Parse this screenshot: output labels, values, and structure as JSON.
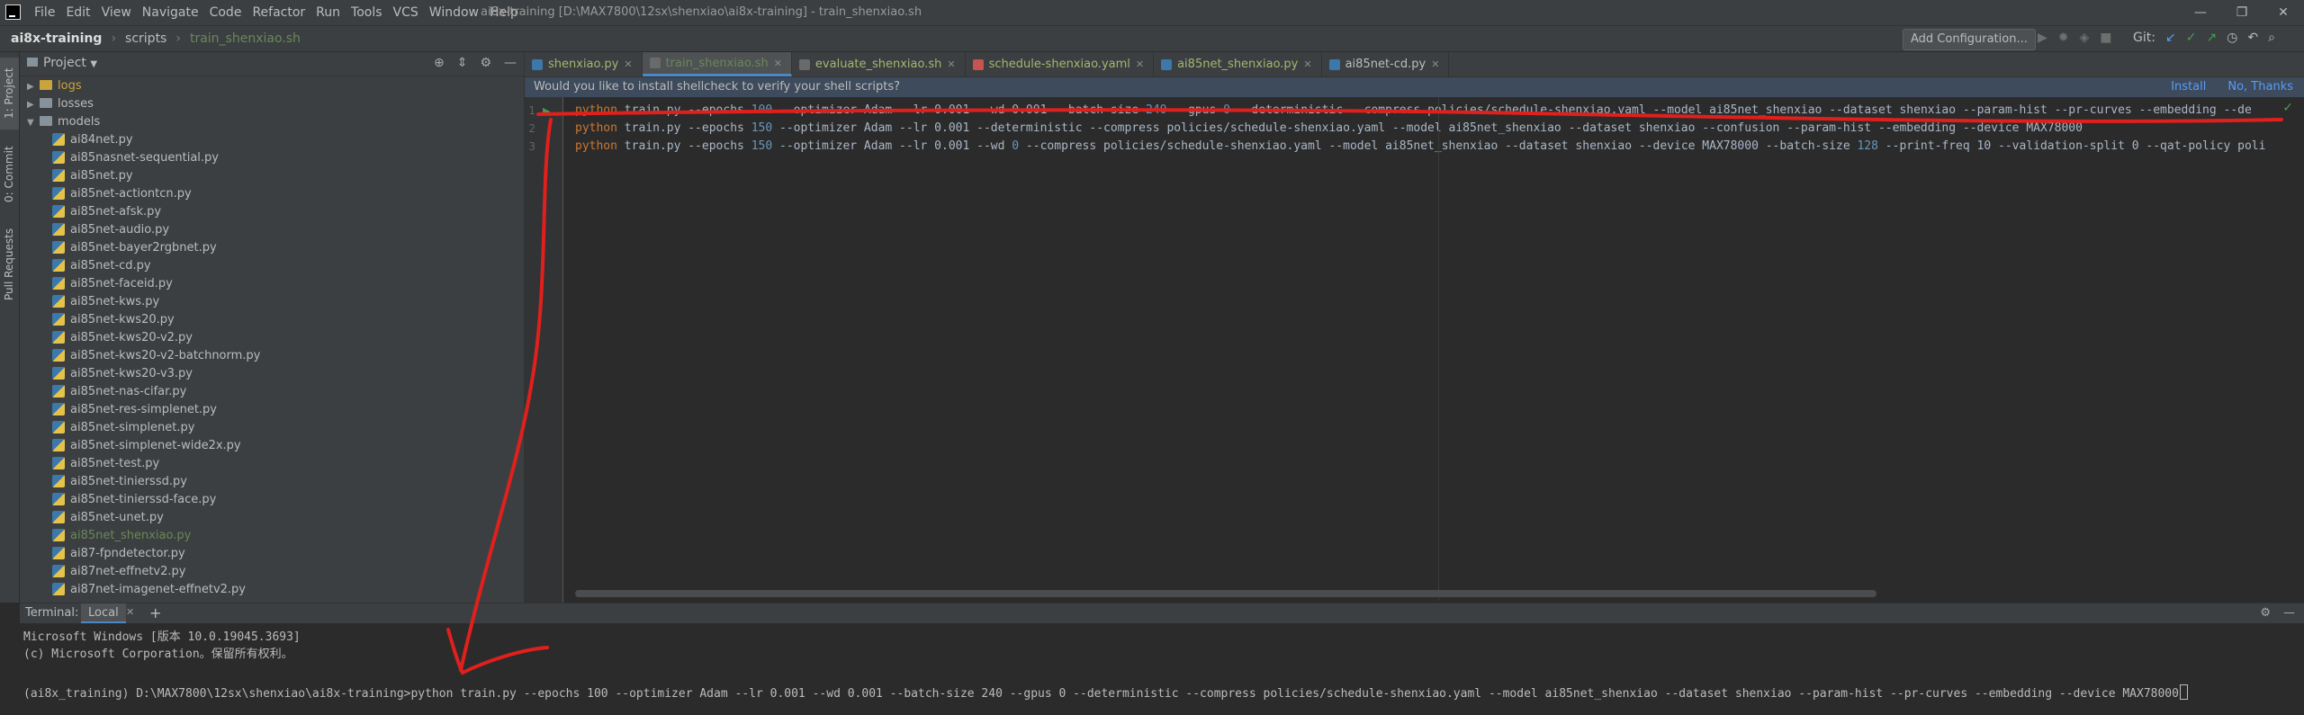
{
  "menubar": {
    "items": [
      "File",
      "Edit",
      "View",
      "Navigate",
      "Code",
      "Refactor",
      "Run",
      "Tools",
      "VCS",
      "Window",
      "Help"
    ],
    "window_title": "ai8x-training [D:\\MAX7800\\12sx\\shenxiao\\ai8x-training] - train_shenxiao.sh",
    "controls": [
      "—",
      "❐",
      "✕"
    ]
  },
  "navbar": {
    "crumbs": [
      "ai8x-training",
      "scripts",
      "train_shenxiao.sh"
    ],
    "add_configuration": "Add Configuration...",
    "git_label": "Git:"
  },
  "left_strip": {
    "tabs": [
      "1: Project",
      "0: Commit",
      "Pull Requests"
    ]
  },
  "project": {
    "title": "Project",
    "tree": [
      {
        "label": "logs",
        "type": "folder",
        "depth": 1,
        "expanded": false,
        "color": "#bbb"
      },
      {
        "label": "losses",
        "type": "folder",
        "depth": 1,
        "expanded": false
      },
      {
        "label": "models",
        "type": "folder",
        "depth": 1,
        "expanded": true
      },
      {
        "label": "ai84net.py",
        "type": "py",
        "depth": 2
      },
      {
        "label": "ai85nasnet-sequential.py",
        "type": "py",
        "depth": 2
      },
      {
        "label": "ai85net.py",
        "type": "py",
        "depth": 2
      },
      {
        "label": "ai85net-actiontcn.py",
        "type": "py",
        "depth": 2
      },
      {
        "label": "ai85net-afsk.py",
        "type": "py",
        "depth": 2
      },
      {
        "label": "ai85net-audio.py",
        "type": "py",
        "depth": 2
      },
      {
        "label": "ai85net-bayer2rgbnet.py",
        "type": "py",
        "depth": 2
      },
      {
        "label": "ai85net-cd.py",
        "type": "py",
        "depth": 2
      },
      {
        "label": "ai85net-faceid.py",
        "type": "py",
        "depth": 2
      },
      {
        "label": "ai85net-kws.py",
        "type": "py",
        "depth": 2
      },
      {
        "label": "ai85net-kws20.py",
        "type": "py",
        "depth": 2
      },
      {
        "label": "ai85net-kws20-v2.py",
        "type": "py",
        "depth": 2
      },
      {
        "label": "ai85net-kws20-v2-batchnorm.py",
        "type": "py",
        "depth": 2
      },
      {
        "label": "ai85net-kws20-v3.py",
        "type": "py",
        "depth": 2
      },
      {
        "label": "ai85net-nas-cifar.py",
        "type": "py",
        "depth": 2
      },
      {
        "label": "ai85net-res-simplenet.py",
        "type": "py",
        "depth": 2
      },
      {
        "label": "ai85net-simplenet.py",
        "type": "py",
        "depth": 2
      },
      {
        "label": "ai85net-simplenet-wide2x.py",
        "type": "py",
        "depth": 2
      },
      {
        "label": "ai85net-test.py",
        "type": "py",
        "depth": 2
      },
      {
        "label": "ai85net-tinierssd.py",
        "type": "py",
        "depth": 2
      },
      {
        "label": "ai85net-tinierssd-face.py",
        "type": "py",
        "depth": 2
      },
      {
        "label": "ai85net-unet.py",
        "type": "py",
        "depth": 2
      },
      {
        "label": "ai85net_shenxiao.py",
        "type": "py",
        "depth": 2,
        "highlight": true
      },
      {
        "label": "ai87-fpndetector.py",
        "type": "py",
        "depth": 2
      },
      {
        "label": "ai87net-effnetv2.py",
        "type": "py",
        "depth": 2
      },
      {
        "label": "ai87net-imagenet-effnetv2.py",
        "type": "py",
        "depth": 2
      }
    ]
  },
  "editor": {
    "tabs": [
      {
        "label": "shenxiao.py",
        "icon": "#3c78aa",
        "active": false
      },
      {
        "label": "train_shenxiao.sh",
        "icon": "#6a6a6a",
        "active": true
      },
      {
        "label": "evaluate_shenxiao.sh",
        "icon": "#6a6a6a",
        "active": false
      },
      {
        "label": "schedule-shenxiao.yaml",
        "icon": "#c75450",
        "active": false
      },
      {
        "label": "ai85net_shenxiao.py",
        "icon": "#3c78aa",
        "active": false
      },
      {
        "label": "ai85net-cd.py",
        "icon": "#3c78aa",
        "active": false
      }
    ],
    "banner": {
      "message": "Would you like to install shellcheck to verify your shell scripts?",
      "install": "Install",
      "no_thanks": "No, Thanks"
    },
    "lines": [
      {
        "n": "1",
        "kw": "python",
        "num": "100",
        "text_a": " train.py --epochs ",
        "text_b": " --optimizer Adam --lr 0.001 --wd 0.001 --batch-size ",
        "num2": "240",
        "text_c": " --gpus ",
        "num3": "0",
        "text_d": " --deterministic --compress policies/schedule-shenxiao.yaml --model ai85net_shenxiao --dataset shenxiao --param-hist --pr-curves --embedding --de"
      },
      {
        "n": "2",
        "kw": "python",
        "num": "150",
        "text_a": " train.py --epochs ",
        "text_b": " --optimizer Adam --lr 0.001 --deterministic --compress policies/schedule-shenxiao.yaml --model ai85net_shenxiao --dataset shenxiao --confusion --param-hist --embedding --device MAX78000",
        "num2": "",
        "text_c": "",
        "num3": "",
        "text_d": ""
      },
      {
        "n": "3",
        "kw": "python",
        "num": "150",
        "text_a": " train.py --epochs ",
        "text_b": " --optimizer Adam --lr 0.001 --wd ",
        "num2": "0",
        "text_c": " --compress policies/schedule-shenxiao.yaml --model ai85net_shenxiao --dataset shenxiao --device MAX78000 --batch-size ",
        "num3": "128",
        "text_d": " --print-freq 10 --validation-split 0 --qat-policy poli"
      }
    ]
  },
  "terminal": {
    "title": "Terminal:",
    "tab": "Local",
    "lines": [
      "Microsoft Windows [版本 10.0.19045.3693]",
      "(c) Microsoft Corporation。保留所有权利。",
      "",
      "(ai8x_training) D:\\MAX7800\\12sx\\shenxiao\\ai8x-training>python train.py --epochs 100 --optimizer Adam --lr 0.001 --wd 0.001 --batch-size 240 --gpus 0 --deterministic --compress policies/schedule-shenxiao.yaml --model ai85net_shenxiao --dataset shenxiao --param-hist --pr-curves --embedding --device MAX78000"
    ]
  },
  "annotation": {
    "color": "#e0201c"
  }
}
